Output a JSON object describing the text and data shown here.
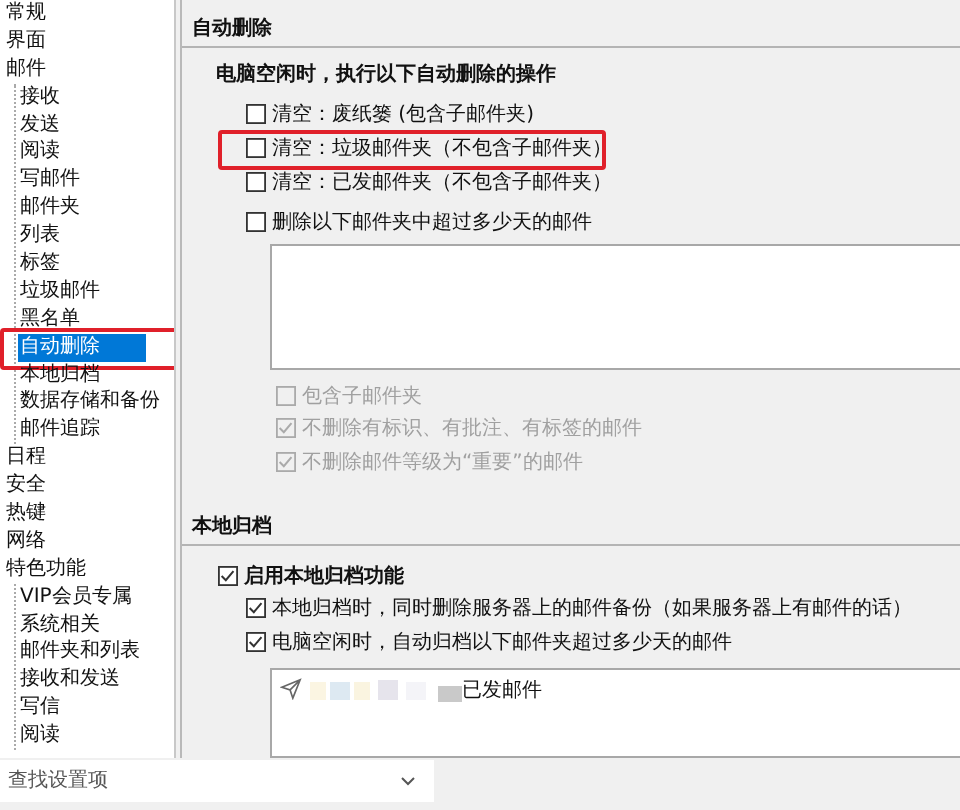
{
  "sidebar": {
    "items": [
      {
        "label": "常规",
        "selected": false,
        "highlighted": false
      },
      {
        "label": "界面",
        "selected": false,
        "highlighted": false
      },
      {
        "label": "邮件",
        "selected": false,
        "highlighted": false,
        "children": [
          {
            "label": "接收",
            "selected": false,
            "highlighted": false
          },
          {
            "label": "发送",
            "selected": false,
            "highlighted": false
          },
          {
            "label": "阅读",
            "selected": false,
            "highlighted": false
          },
          {
            "label": "写邮件",
            "selected": false,
            "highlighted": false
          },
          {
            "label": "邮件夹",
            "selected": false,
            "highlighted": false
          },
          {
            "label": "列表",
            "selected": false,
            "highlighted": false
          },
          {
            "label": "标签",
            "selected": false,
            "highlighted": false
          },
          {
            "label": "垃圾邮件",
            "selected": false,
            "highlighted": false
          },
          {
            "label": "黑名单",
            "selected": false,
            "highlighted": false
          },
          {
            "label": "自动删除",
            "selected": true,
            "highlighted": true
          },
          {
            "label": "本地归档",
            "selected": false,
            "highlighted": false
          },
          {
            "label": "数据存储和备份",
            "selected": false,
            "highlighted": false
          },
          {
            "label": "邮件追踪",
            "selected": false,
            "highlighted": false
          }
        ]
      },
      {
        "label": "日程",
        "selected": false,
        "highlighted": false
      },
      {
        "label": "安全",
        "selected": false,
        "highlighted": false
      },
      {
        "label": "热键",
        "selected": false,
        "highlighted": false
      },
      {
        "label": "网络",
        "selected": false,
        "highlighted": false
      },
      {
        "label": "特色功能",
        "selected": false,
        "highlighted": false,
        "children": [
          {
            "label": "VIP会员专属",
            "selected": false,
            "highlighted": false
          },
          {
            "label": "系统相关",
            "selected": false,
            "highlighted": false
          },
          {
            "label": "邮件夹和列表",
            "selected": false,
            "highlighted": false
          },
          {
            "label": "接收和发送",
            "selected": false,
            "highlighted": false
          },
          {
            "label": "写信",
            "selected": false,
            "highlighted": false
          },
          {
            "label": "阅读",
            "selected": false,
            "highlighted": false
          }
        ]
      }
    ]
  },
  "search": {
    "placeholder": "查找设置项"
  },
  "auto_delete": {
    "title": "自动删除",
    "subtitle": "电脑空闲时，执行以下自动删除的操作",
    "options": [
      {
        "label": "清空：废纸篓 (包含子邮件夹)",
        "checked": false,
        "highlighted": false
      },
      {
        "label": "清空：垃圾邮件夹（不包含子邮件夹）",
        "checked": false,
        "highlighted": true
      },
      {
        "label": "清空：已发邮件夹（不包含子邮件夹）",
        "checked": false,
        "highlighted": false
      }
    ],
    "age_option": {
      "label": "删除以下邮件夹中超过多少天的邮件",
      "checked": false
    },
    "sub_options": [
      {
        "label": "包含子邮件夹",
        "checked": false,
        "disabled": true
      },
      {
        "label": "不删除有标识、有批注、有标签的邮件",
        "checked": true,
        "disabled": true
      },
      {
        "label": "不删除邮件等级为“重要”的邮件",
        "checked": true,
        "disabled": true
      }
    ]
  },
  "local_archive": {
    "title": "本地归档",
    "enable": {
      "label": "启用本地归档功能",
      "checked": true
    },
    "options": [
      {
        "label": "本地归档时，同时删除服务器上的邮件备份（如果服务器上有邮件的话）",
        "checked": true
      },
      {
        "label": "电脑空闲时，自动归档以下邮件夹超过多少天的邮件",
        "checked": true
      }
    ],
    "folders": [
      {
        "name": "已发邮件"
      }
    ]
  }
}
